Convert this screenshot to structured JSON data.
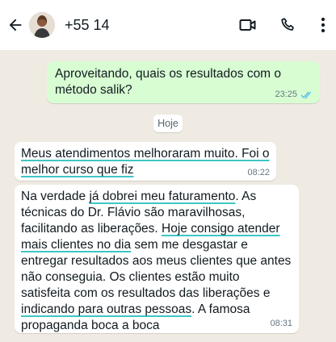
{
  "header": {
    "contact_name": "+55 14",
    "icons": [
      "back-arrow-icon",
      "avatar",
      "video-call-icon",
      "phone-icon",
      "more-vert-icon"
    ]
  },
  "messages": {
    "outgoing_1": {
      "text": "Aproveitando, quais os resultados com o método salik?",
      "time": "23:25"
    },
    "day_label": "Hoje",
    "incoming_1": {
      "part1": "Meus atendimentos melhoraram muito. Foi o melhor curso que fiz",
      "time": "08:22"
    },
    "incoming_2": {
      "p1": "Na verdade ",
      "p2": "já dobrei meu faturamento",
      "p3": ". As técnicas do Dr. Flávio são maravilhosas, facilitando as liberações. ",
      "p4": "Hoje consigo atender mais clientes no dia",
      "p5": " sem me desgastar e entregar resultados aos meus clientes que antes não conseguia. Os clientes estão muito satisfeita com os resultados das liberações e ",
      "p6": "indicando para outras pessoas",
      "p7": ". A famosa propaganda boca a boca",
      "time": "08:31"
    }
  },
  "colors": {
    "chat_bg": "#efeae2",
    "outgoing_bubble": "#d9fdd3",
    "incoming_bubble": "#ffffff",
    "highlight_underline": "#3ec6c4",
    "read_ticks": "#53bdeb"
  }
}
